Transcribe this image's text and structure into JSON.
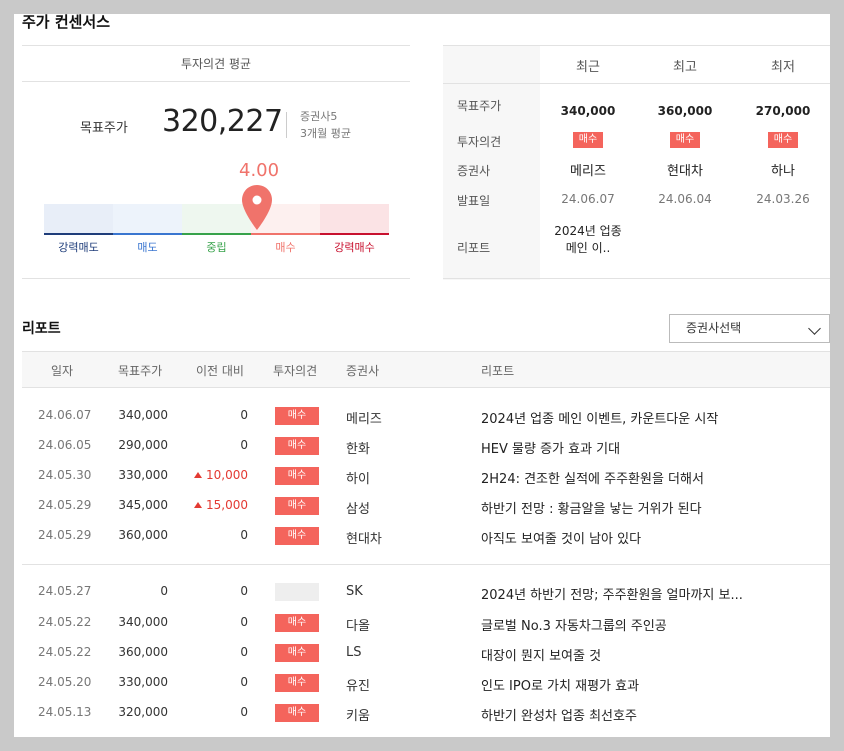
{
  "section_title": "주가 컨센서스",
  "opinion": {
    "header": "투자의견 평균",
    "target_label": "목표주가",
    "target_value": "320,227",
    "broker_count": "증권사5",
    "avg_period": "3개월 평균",
    "score": "4.00",
    "score_fraction": 0.75,
    "scale": [
      {
        "label": "강력매도",
        "color": "#1f3d7a",
        "bg": "#e8eef8"
      },
      {
        "label": "매도",
        "color": "#3a76d0",
        "bg": "#edf3fb"
      },
      {
        "label": "중립",
        "color": "#37a24a",
        "bg": "#eef7ef"
      },
      {
        "label": "매수",
        "color": "#f0736b",
        "bg": "#fdf0ef"
      },
      {
        "label": "강력매수",
        "color": "#c8102e",
        "bg": "#fbe3e5"
      }
    ]
  },
  "summary": {
    "columns": [
      "최근",
      "최고",
      "최저"
    ],
    "row_labels": [
      "목표주가",
      "투자의견",
      "증권사",
      "발표일",
      "리포트"
    ],
    "cols": [
      {
        "price": "340,000",
        "opinion": "매수",
        "broker": "메리즈",
        "date": "24.06.07",
        "report_l1": "2024년 업종",
        "report_l2": "메인 이.."
      },
      {
        "price": "360,000",
        "opinion": "매수",
        "broker": "현대차",
        "date": "24.06.04",
        "report_l1": "",
        "report_l2": ""
      },
      {
        "price": "270,000",
        "opinion": "매수",
        "broker": "하나",
        "date": "24.03.26",
        "report_l1": "",
        "report_l2": ""
      }
    ]
  },
  "reports": {
    "title": "리포트",
    "select_label": "증권사선택",
    "headers": [
      "일자",
      "목표주가",
      "이전 대비",
      "투자의견",
      "증권사",
      "리포트"
    ],
    "rows": [
      {
        "date": "24.06.07",
        "target": "340,000",
        "diff": "0",
        "up": false,
        "opinion": "매수",
        "broker": "메리즈",
        "report": "2024년 업종 메인 이벤트, 카운트다운 시작"
      },
      {
        "date": "24.06.05",
        "target": "290,000",
        "diff": "0",
        "up": false,
        "opinion": "매수",
        "broker": "한화",
        "report": "HEV 물량 증가 효과 기대"
      },
      {
        "date": "24.05.30",
        "target": "330,000",
        "diff": "10,000",
        "up": true,
        "opinion": "매수",
        "broker": "하이",
        "report": "2H24: 견조한 실적에 주주환원을 더해서"
      },
      {
        "date": "24.05.29",
        "target": "345,000",
        "diff": "15,000",
        "up": true,
        "opinion": "매수",
        "broker": "삼성",
        "report": "하반기 전망 : 황금알을 낳는 거위가 된다"
      },
      {
        "date": "24.05.29",
        "target": "360,000",
        "diff": "0",
        "up": false,
        "opinion": "매수",
        "broker": "현대차",
        "report": "아직도 보여줄 것이 남아 있다"
      },
      {
        "date": "24.05.27",
        "target": "0",
        "diff": "0",
        "up": false,
        "opinion": "",
        "broker": "SK",
        "report": "2024년 하반기 전망; 주주환원을 얼마까지 보..."
      },
      {
        "date": "24.05.22",
        "target": "340,000",
        "diff": "0",
        "up": false,
        "opinion": "매수",
        "broker": "다올",
        "report": "글로벌 No.3 자동차그룹의 주인공"
      },
      {
        "date": "24.05.22",
        "target": "360,000",
        "diff": "0",
        "up": false,
        "opinion": "매수",
        "broker": "LS",
        "report": "대장이 뭔지 보여줄 것"
      },
      {
        "date": "24.05.20",
        "target": "330,000",
        "diff": "0",
        "up": false,
        "opinion": "매수",
        "broker": "유진",
        "report": "인도 IPO로 가치 재평가 효과"
      },
      {
        "date": "24.05.13",
        "target": "320,000",
        "diff": "0",
        "up": false,
        "opinion": "매수",
        "broker": "키움",
        "report": "하반기 완성차 업종 최선호주"
      }
    ]
  }
}
